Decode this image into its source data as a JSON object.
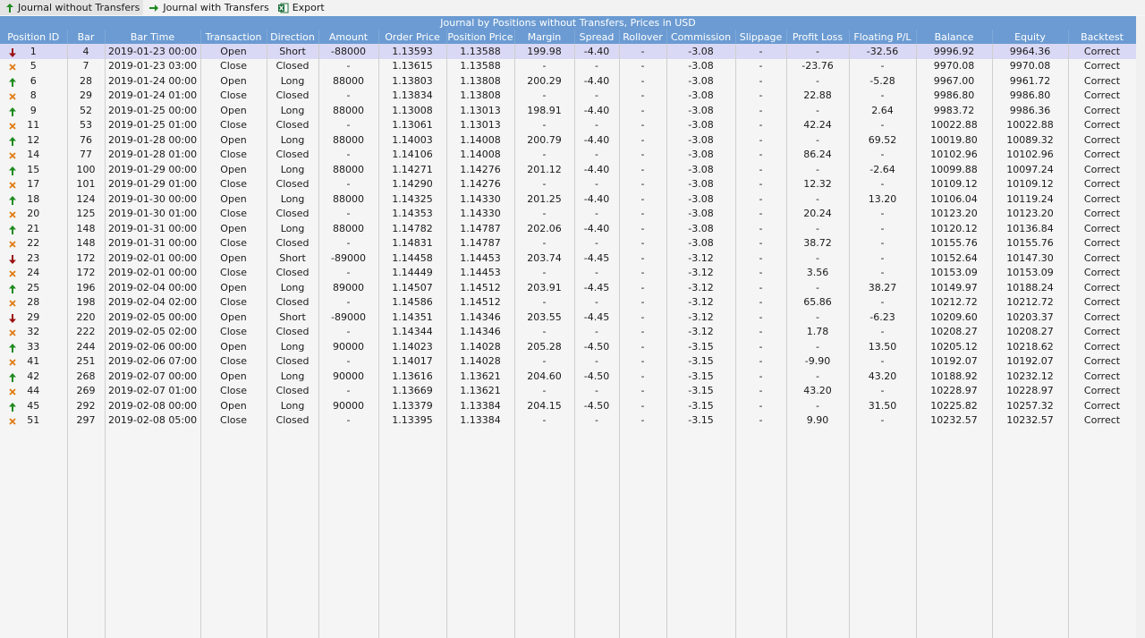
{
  "toolbar": {
    "journal_without_transfers": "Journal without Transfers",
    "journal_with_transfers": "Journal with Transfers",
    "export": "Export"
  },
  "table": {
    "caption": "Journal by Positions without Transfers, Prices in USD",
    "columns": [
      "Position ID",
      "Bar",
      "Bar Time",
      "Transaction",
      "Direction",
      "Amount",
      "Order Price",
      "Position Price",
      "Margin",
      "Spread",
      "Rollover",
      "Commission",
      "Slippage",
      "Profit Loss",
      "Floating P/L",
      "Balance",
      "Equity",
      "Backtest"
    ],
    "rows": [
      {
        "icon": "down",
        "c": [
          "1",
          "4",
          "2019-01-23 00:00",
          "Open",
          "Short",
          "-88000",
          "1.13593",
          "1.13588",
          "199.98",
          "-4.40",
          "-",
          "-3.08",
          "-",
          "-",
          "-32.56",
          "9996.92",
          "9964.36",
          "Correct"
        ]
      },
      {
        "icon": "close",
        "c": [
          "5",
          "7",
          "2019-01-23 03:00",
          "Close",
          "Closed",
          "-",
          "1.13615",
          "1.13588",
          "-",
          "-",
          "-",
          "-3.08",
          "-",
          "-23.76",
          "-",
          "9970.08",
          "9970.08",
          "Correct"
        ]
      },
      {
        "icon": "up",
        "c": [
          "6",
          "28",
          "2019-01-24 00:00",
          "Open",
          "Long",
          "88000",
          "1.13803",
          "1.13808",
          "200.29",
          "-4.40",
          "-",
          "-3.08",
          "-",
          "-",
          "-5.28",
          "9967.00",
          "9961.72",
          "Correct"
        ]
      },
      {
        "icon": "close",
        "c": [
          "8",
          "29",
          "2019-01-24 01:00",
          "Close",
          "Closed",
          "-",
          "1.13834",
          "1.13808",
          "-",
          "-",
          "-",
          "-3.08",
          "-",
          "22.88",
          "-",
          "9986.80",
          "9986.80",
          "Correct"
        ]
      },
      {
        "icon": "up",
        "c": [
          "9",
          "52",
          "2019-01-25 00:00",
          "Open",
          "Long",
          "88000",
          "1.13008",
          "1.13013",
          "198.91",
          "-4.40",
          "-",
          "-3.08",
          "-",
          "-",
          "2.64",
          "9983.72",
          "9986.36",
          "Correct"
        ]
      },
      {
        "icon": "close",
        "c": [
          "11",
          "53",
          "2019-01-25 01:00",
          "Close",
          "Closed",
          "-",
          "1.13061",
          "1.13013",
          "-",
          "-",
          "-",
          "-3.08",
          "-",
          "42.24",
          "-",
          "10022.88",
          "10022.88",
          "Correct"
        ]
      },
      {
        "icon": "up",
        "c": [
          "12",
          "76",
          "2019-01-28 00:00",
          "Open",
          "Long",
          "88000",
          "1.14003",
          "1.14008",
          "200.79",
          "-4.40",
          "-",
          "-3.08",
          "-",
          "-",
          "69.52",
          "10019.80",
          "10089.32",
          "Correct"
        ]
      },
      {
        "icon": "close",
        "c": [
          "14",
          "77",
          "2019-01-28 01:00",
          "Close",
          "Closed",
          "-",
          "1.14106",
          "1.14008",
          "-",
          "-",
          "-",
          "-3.08",
          "-",
          "86.24",
          "-",
          "10102.96",
          "10102.96",
          "Correct"
        ]
      },
      {
        "icon": "up",
        "c": [
          "15",
          "100",
          "2019-01-29 00:00",
          "Open",
          "Long",
          "88000",
          "1.14271",
          "1.14276",
          "201.12",
          "-4.40",
          "-",
          "-3.08",
          "-",
          "-",
          "-2.64",
          "10099.88",
          "10097.24",
          "Correct"
        ]
      },
      {
        "icon": "close",
        "c": [
          "17",
          "101",
          "2019-01-29 01:00",
          "Close",
          "Closed",
          "-",
          "1.14290",
          "1.14276",
          "-",
          "-",
          "-",
          "-3.08",
          "-",
          "12.32",
          "-",
          "10109.12",
          "10109.12",
          "Correct"
        ]
      },
      {
        "icon": "up",
        "c": [
          "18",
          "124",
          "2019-01-30 00:00",
          "Open",
          "Long",
          "88000",
          "1.14325",
          "1.14330",
          "201.25",
          "-4.40",
          "-",
          "-3.08",
          "-",
          "-",
          "13.20",
          "10106.04",
          "10119.24",
          "Correct"
        ]
      },
      {
        "icon": "close",
        "c": [
          "20",
          "125",
          "2019-01-30 01:00",
          "Close",
          "Closed",
          "-",
          "1.14353",
          "1.14330",
          "-",
          "-",
          "-",
          "-3.08",
          "-",
          "20.24",
          "-",
          "10123.20",
          "10123.20",
          "Correct"
        ]
      },
      {
        "icon": "up",
        "c": [
          "21",
          "148",
          "2019-01-31 00:00",
          "Open",
          "Long",
          "88000",
          "1.14782",
          "1.14787",
          "202.06",
          "-4.40",
          "-",
          "-3.08",
          "-",
          "-",
          "-",
          "10120.12",
          "10136.84",
          "Correct"
        ]
      },
      {
        "icon": "close",
        "c": [
          "22",
          "148",
          "2019-01-31 00:00",
          "Close",
          "Closed",
          "-",
          "1.14831",
          "1.14787",
          "-",
          "-",
          "-",
          "-3.08",
          "-",
          "38.72",
          "-",
          "10155.76",
          "10155.76",
          "Correct"
        ]
      },
      {
        "icon": "down",
        "c": [
          "23",
          "172",
          "2019-02-01 00:00",
          "Open",
          "Short",
          "-89000",
          "1.14458",
          "1.14453",
          "203.74",
          "-4.45",
          "-",
          "-3.12",
          "-",
          "-",
          "-",
          "10152.64",
          "10147.30",
          "Correct"
        ]
      },
      {
        "icon": "close",
        "c": [
          "24",
          "172",
          "2019-02-01 00:00",
          "Close",
          "Closed",
          "-",
          "1.14449",
          "1.14453",
          "-",
          "-",
          "-",
          "-3.12",
          "-",
          "3.56",
          "-",
          "10153.09",
          "10153.09",
          "Correct"
        ]
      },
      {
        "icon": "up",
        "c": [
          "25",
          "196",
          "2019-02-04 00:00",
          "Open",
          "Long",
          "89000",
          "1.14507",
          "1.14512",
          "203.91",
          "-4.45",
          "-",
          "-3.12",
          "-",
          "-",
          "38.27",
          "10149.97",
          "10188.24",
          "Correct"
        ]
      },
      {
        "icon": "close",
        "c": [
          "28",
          "198",
          "2019-02-04 02:00",
          "Close",
          "Closed",
          "-",
          "1.14586",
          "1.14512",
          "-",
          "-",
          "-",
          "-3.12",
          "-",
          "65.86",
          "-",
          "10212.72",
          "10212.72",
          "Correct"
        ]
      },
      {
        "icon": "down",
        "c": [
          "29",
          "220",
          "2019-02-05 00:00",
          "Open",
          "Short",
          "-89000",
          "1.14351",
          "1.14346",
          "203.55",
          "-4.45",
          "-",
          "-3.12",
          "-",
          "-",
          "-6.23",
          "10209.60",
          "10203.37",
          "Correct"
        ]
      },
      {
        "icon": "close",
        "c": [
          "32",
          "222",
          "2019-02-05 02:00",
          "Close",
          "Closed",
          "-",
          "1.14344",
          "1.14346",
          "-",
          "-",
          "-",
          "-3.12",
          "-",
          "1.78",
          "-",
          "10208.27",
          "10208.27",
          "Correct"
        ]
      },
      {
        "icon": "up",
        "c": [
          "33",
          "244",
          "2019-02-06 00:00",
          "Open",
          "Long",
          "90000",
          "1.14023",
          "1.14028",
          "205.28",
          "-4.50",
          "-",
          "-3.15",
          "-",
          "-",
          "13.50",
          "10205.12",
          "10218.62",
          "Correct"
        ]
      },
      {
        "icon": "close",
        "c": [
          "41",
          "251",
          "2019-02-06 07:00",
          "Close",
          "Closed",
          "-",
          "1.14017",
          "1.14028",
          "-",
          "-",
          "-",
          "-3.15",
          "-",
          "-9.90",
          "-",
          "10192.07",
          "10192.07",
          "Correct"
        ]
      },
      {
        "icon": "up",
        "c": [
          "42",
          "268",
          "2019-02-07 00:00",
          "Open",
          "Long",
          "90000",
          "1.13616",
          "1.13621",
          "204.60",
          "-4.50",
          "-",
          "-3.15",
          "-",
          "-",
          "43.20",
          "10188.92",
          "10232.12",
          "Correct"
        ]
      },
      {
        "icon": "close",
        "c": [
          "44",
          "269",
          "2019-02-07 01:00",
          "Close",
          "Closed",
          "-",
          "1.13669",
          "1.13621",
          "-",
          "-",
          "-",
          "-3.15",
          "-",
          "43.20",
          "-",
          "10228.97",
          "10228.97",
          "Correct"
        ]
      },
      {
        "icon": "up",
        "c": [
          "45",
          "292",
          "2019-02-08 00:00",
          "Open",
          "Long",
          "90000",
          "1.13379",
          "1.13384",
          "204.15",
          "-4.50",
          "-",
          "-3.15",
          "-",
          "-",
          "31.50",
          "10225.82",
          "10257.32",
          "Correct"
        ]
      },
      {
        "icon": "close",
        "c": [
          "51",
          "297",
          "2019-02-08 05:00",
          "Close",
          "Closed",
          "-",
          "1.13395",
          "1.13384",
          "-",
          "-",
          "-",
          "-3.15",
          "-",
          "9.90",
          "-",
          "10232.57",
          "10232.57",
          "Correct"
        ]
      }
    ],
    "icon_colors": {
      "up": "#1e8a1e",
      "down": "#9b1010",
      "close": "#e07a10"
    }
  }
}
